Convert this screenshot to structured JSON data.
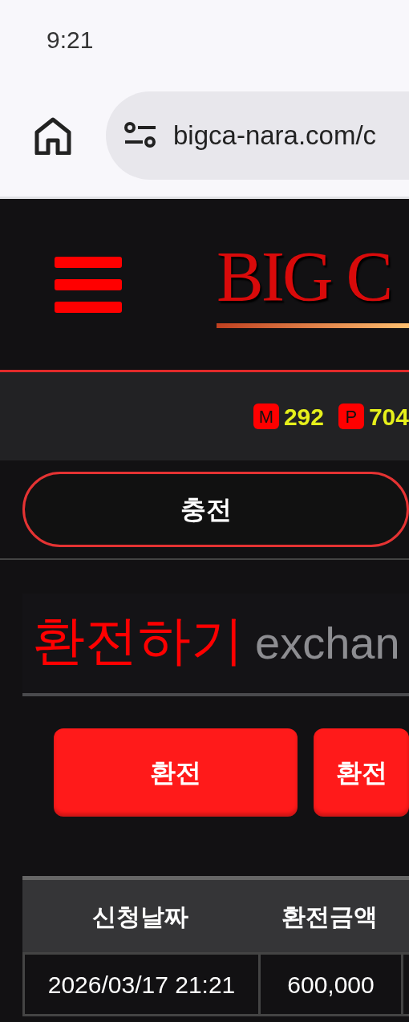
{
  "status_bar": {
    "time": "9:21"
  },
  "browser": {
    "url": "bigca-nara.com/c"
  },
  "header": {
    "logo": "BIG C"
  },
  "balances": [
    {
      "badge": "M",
      "value": "292"
    },
    {
      "badge": "P",
      "value": "704"
    }
  ],
  "charge_button": {
    "label": "충전"
  },
  "heading": {
    "title": "환전하기",
    "subtitle": "exchan"
  },
  "action_buttons": [
    "환전",
    "환전"
  ],
  "table": {
    "columns": [
      "신청날짜",
      "환전금액"
    ],
    "rows": [
      [
        "2026/03/17 21:21",
        "600,000"
      ]
    ]
  }
}
